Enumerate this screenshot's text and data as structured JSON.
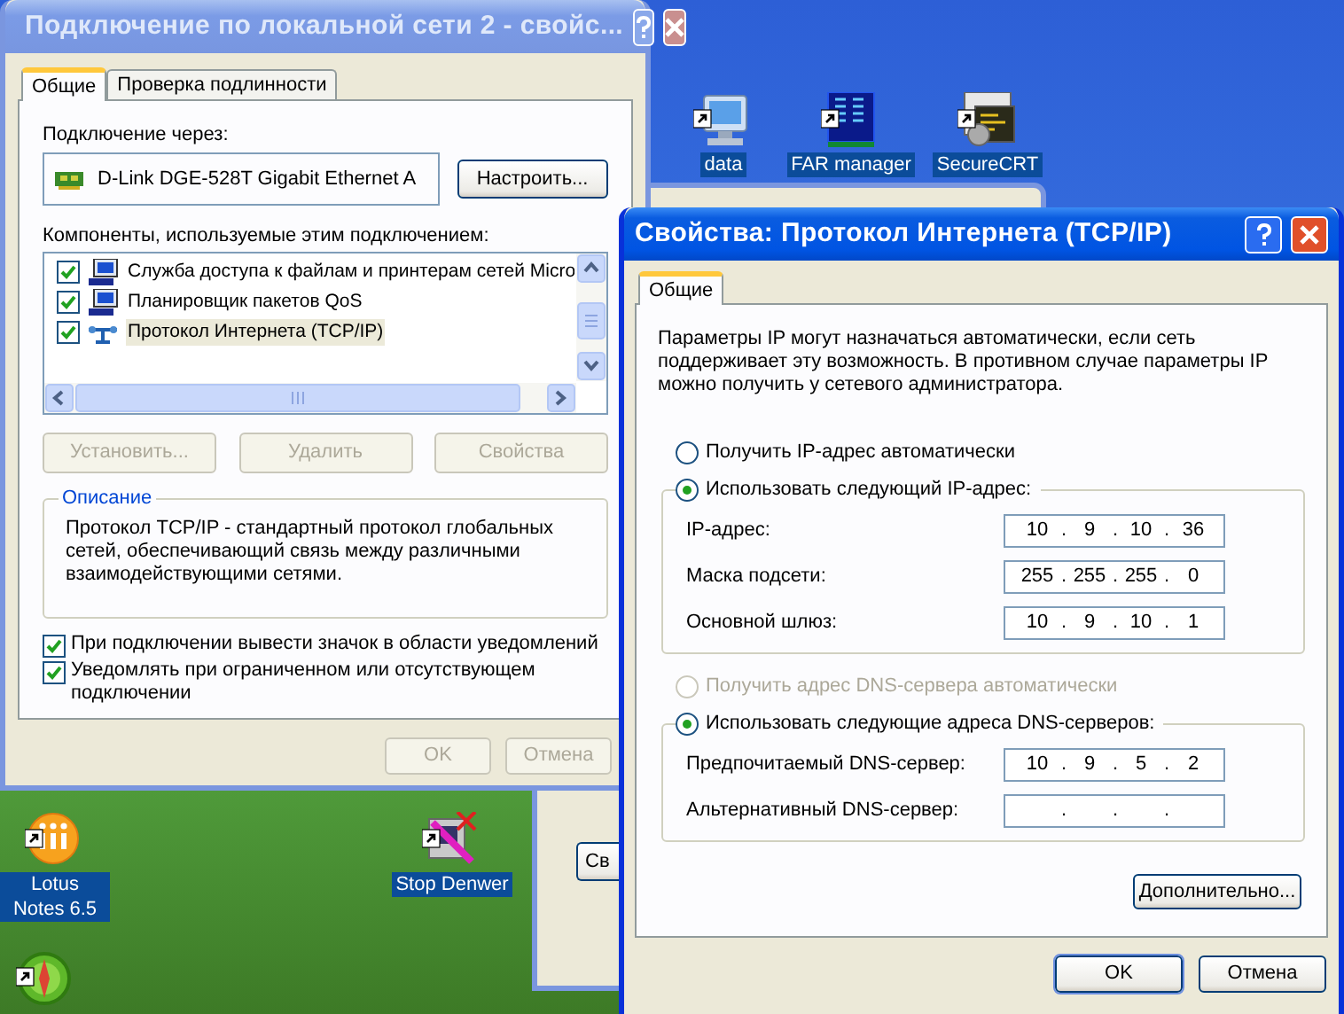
{
  "desktop_icons": [
    {
      "kind": "computer",
      "label": "data",
      "selected": true
    },
    {
      "kind": "server",
      "label": "FAR manager",
      "selected": true
    },
    {
      "kind": "terminal",
      "label": "SecureCRT",
      "selected": true
    },
    {
      "kind": "orange-circle",
      "label": "Lotus Notes 6.5",
      "selected": true
    },
    {
      "kind": "crossed",
      "label": "Stop Denwer",
      "selected": true
    },
    {
      "kind": "compass"
    }
  ],
  "back_window": {
    "button": "Св"
  },
  "connection_window": {
    "title": "Подключение по локальной сети 2 - свойс...",
    "active": false,
    "tabs": [
      {
        "label": "Общие",
        "selected": true
      },
      {
        "label": "Проверка подлинности",
        "selected": false
      }
    ],
    "connect_via_label": "Подключение через:",
    "adapter": "D-Link DGE-528T Gigabit Ethernet A",
    "configure_button": "Настроить...",
    "components_label": "Компоненты, используемые этим подключением:",
    "components": [
      {
        "kind": "service",
        "label": "Служба доступа к файлам и принтерам сетей Micro",
        "checked": true,
        "selected": false
      },
      {
        "kind": "service",
        "label": "Планировщик пакетов QoS",
        "checked": true,
        "selected": false
      },
      {
        "kind": "protocol",
        "label": "Протокол Интернета (TCP/IP)",
        "checked": true,
        "selected": true
      }
    ],
    "component_buttons": [
      {
        "label": "Установить...",
        "disabled": true
      },
      {
        "label": "Удалить",
        "disabled": true
      },
      {
        "label": "Свойства",
        "disabled": true
      }
    ],
    "description": {
      "title": "Описание",
      "text": "Протокол TCP/IP - стандартный протокол глобальных сетей, обеспечивающий связь между различными взаимодействующими сетями."
    },
    "options": [
      {
        "label": "При подключении вывести значок в области уведомлений",
        "checked": true
      },
      {
        "label": "Уведомлять при ограниченном или отсутствующем подключении",
        "checked": true
      }
    ],
    "buttons": [
      {
        "label": "OK",
        "disabled": true
      },
      {
        "label": "Отмена",
        "disabled": true
      }
    ]
  },
  "tcpip_window": {
    "title": "Свойства: Протокол Интернета (TCP/IP)",
    "active": true,
    "tabs": [
      {
        "label": "Общие",
        "selected": true
      }
    ],
    "intro": "Параметры IP могут назначаться автоматически, если сеть поддерживает эту возможность. В противном случае параметры IP можно получить у сетевого администратора.",
    "separator": ".",
    "ip_mode": [
      {
        "label": "Получить IP-адрес автоматически",
        "selected": false,
        "disabled": false
      },
      {
        "label": "Использовать следующий IP-адрес:",
        "selected": true,
        "disabled": false
      }
    ],
    "ip_fields": [
      {
        "label": "IP-адрес:",
        "octets": [
          "10",
          "9",
          "10",
          "36"
        ]
      },
      {
        "label": "Маска подсети:",
        "octets": [
          "255",
          "255",
          "255",
          "0"
        ]
      },
      {
        "label": "Основной шлюз:",
        "octets": [
          "10",
          "9",
          "10",
          "1"
        ]
      }
    ],
    "dns_mode": [
      {
        "label": "Получить адрес DNS-сервера автоматически",
        "selected": false,
        "disabled": true
      },
      {
        "label": "Использовать следующие адреса DNS-серверов:",
        "selected": true,
        "disabled": false
      }
    ],
    "dns_fields": [
      {
        "label": "Предпочитаемый DNS-сервер:",
        "octets": [
          "10",
          "9",
          "5",
          "2"
        ]
      },
      {
        "label": "Альтернативный DNS-сервер:"
      }
    ],
    "advanced_button": "Дополнительно...",
    "buttons": [
      {
        "label": "OK",
        "default": true
      },
      {
        "label": "Отмена",
        "default": false
      }
    ]
  }
}
